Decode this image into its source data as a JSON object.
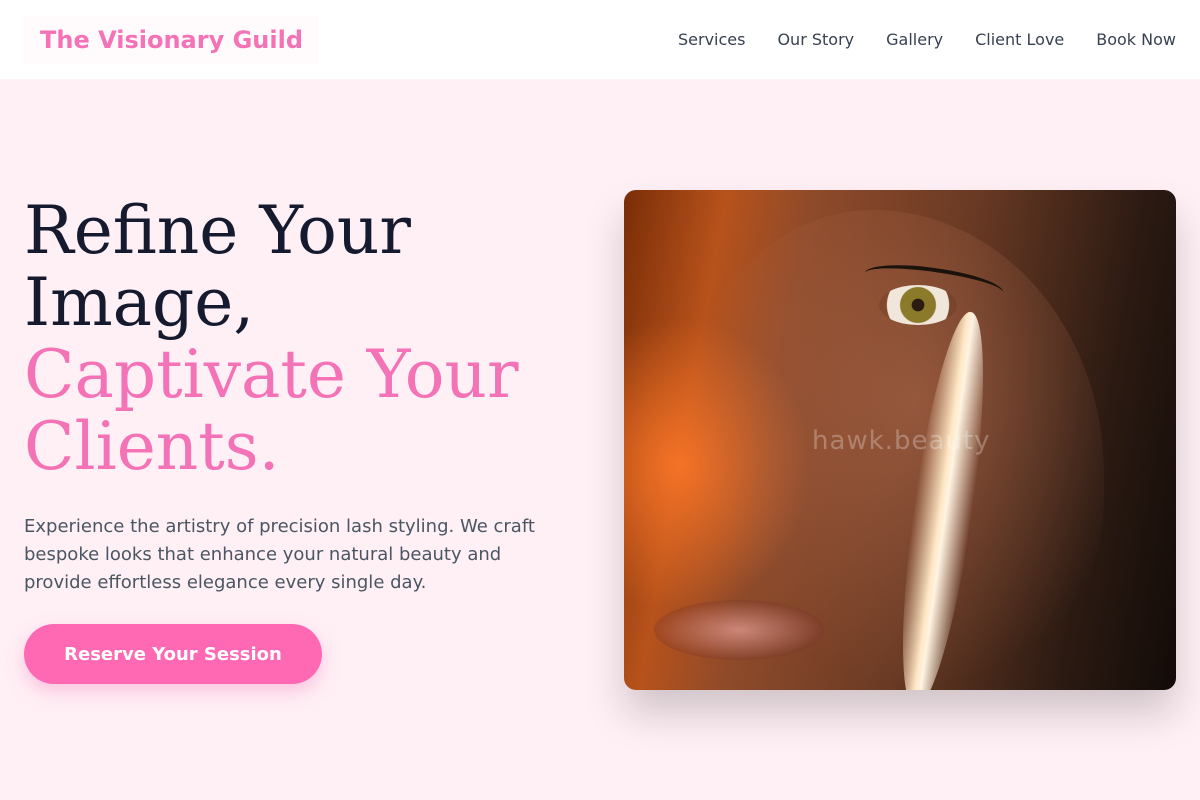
{
  "brand": {
    "name": "The Visionary Guild"
  },
  "nav": {
    "items": [
      {
        "label": "Services"
      },
      {
        "label": "Our Story"
      },
      {
        "label": "Gallery"
      },
      {
        "label": "Client Love"
      },
      {
        "label": "Book Now"
      }
    ]
  },
  "hero": {
    "headline_line1": "Refine Your",
    "headline_line2": "Image,",
    "headline_accent_line1": "Captivate Your",
    "headline_accent_line2": "Clients.",
    "description": "Experience the artistry of precision lash styling. We craft bespoke looks that enhance your natural beauty and provide effortless elegance every single day.",
    "cta_label": "Reserve Your Session",
    "image_watermark": "hawk.beauty"
  },
  "colors": {
    "accent": "#f472b6",
    "button": "#ff69b4",
    "page_background": "#fff0f5",
    "headline_text": "#161a2e"
  }
}
